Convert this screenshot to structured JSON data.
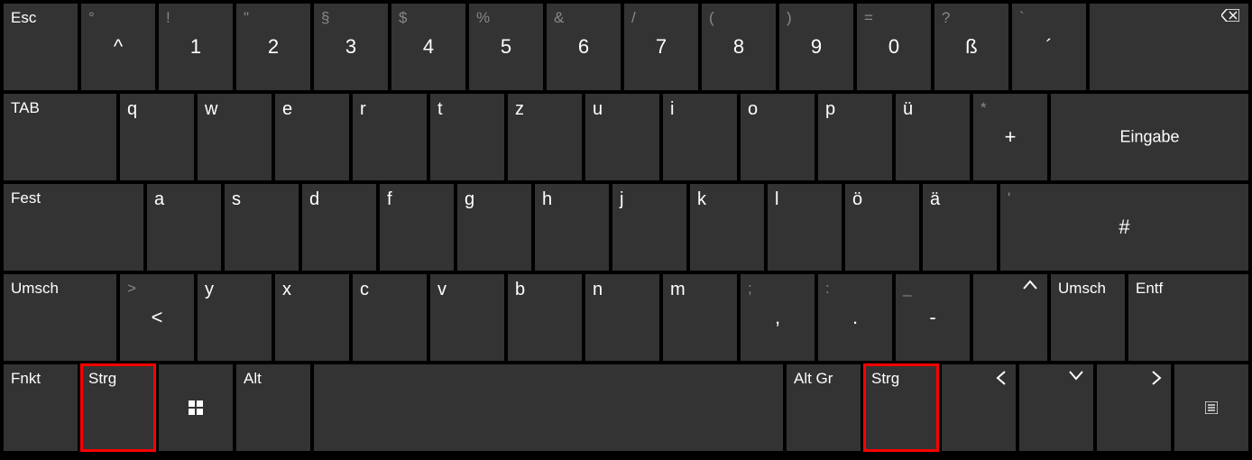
{
  "row1": {
    "esc": "Esc",
    "caret": {
      "top": "°",
      "main": "^"
    },
    "k1": {
      "top": "!",
      "main": "1"
    },
    "k2": {
      "top": "\"",
      "main": "2"
    },
    "k3": {
      "top": "§",
      "main": "3"
    },
    "k4": {
      "top": "$",
      "main": "4"
    },
    "k5": {
      "top": "%",
      "main": "5"
    },
    "k6": {
      "top": "&",
      "main": "6"
    },
    "k7": {
      "top": "/",
      "main": "7"
    },
    "k8": {
      "top": "(",
      "main": "8"
    },
    "k9": {
      "top": ")",
      "main": "9"
    },
    "k0": {
      "top": "=",
      "main": "0"
    },
    "ss": {
      "top": "?",
      "main": "ß"
    },
    "acc": {
      "top": "`",
      "main": "´"
    }
  },
  "row2": {
    "tab": "TAB",
    "q": "q",
    "w": "w",
    "e": "e",
    "r": "r",
    "t": "t",
    "z": "z",
    "u": "u",
    "i": "i",
    "o": "o",
    "p": "p",
    "ue": "ü",
    "plus": {
      "top": "*",
      "main": "+"
    },
    "enter": "Eingabe"
  },
  "row3": {
    "caps": "Fest",
    "a": "a",
    "s": "s",
    "d": "d",
    "f": "f",
    "g": "g",
    "h": "h",
    "j": "j",
    "k": "k",
    "l": "l",
    "oe": "ö",
    "ae": "ä",
    "hash": {
      "top": "'",
      "main": "#"
    }
  },
  "row4": {
    "shiftL": "Umsch",
    "lt": {
      "top": ">",
      "main": "<"
    },
    "y": "y",
    "x": "x",
    "c": "c",
    "v": "v",
    "b": "b",
    "n": "n",
    "m": "m",
    "comma": {
      "top": ";",
      "main": ","
    },
    "dot": {
      "top": ":",
      "main": "."
    },
    "dash": {
      "top": "_",
      "main": "-"
    },
    "shiftR": "Umsch",
    "del": "Entf"
  },
  "row5": {
    "fn": "Fnkt",
    "ctrlL": "Strg",
    "alt": "Alt",
    "altgr": "Alt Gr",
    "ctrlR": "Strg"
  }
}
